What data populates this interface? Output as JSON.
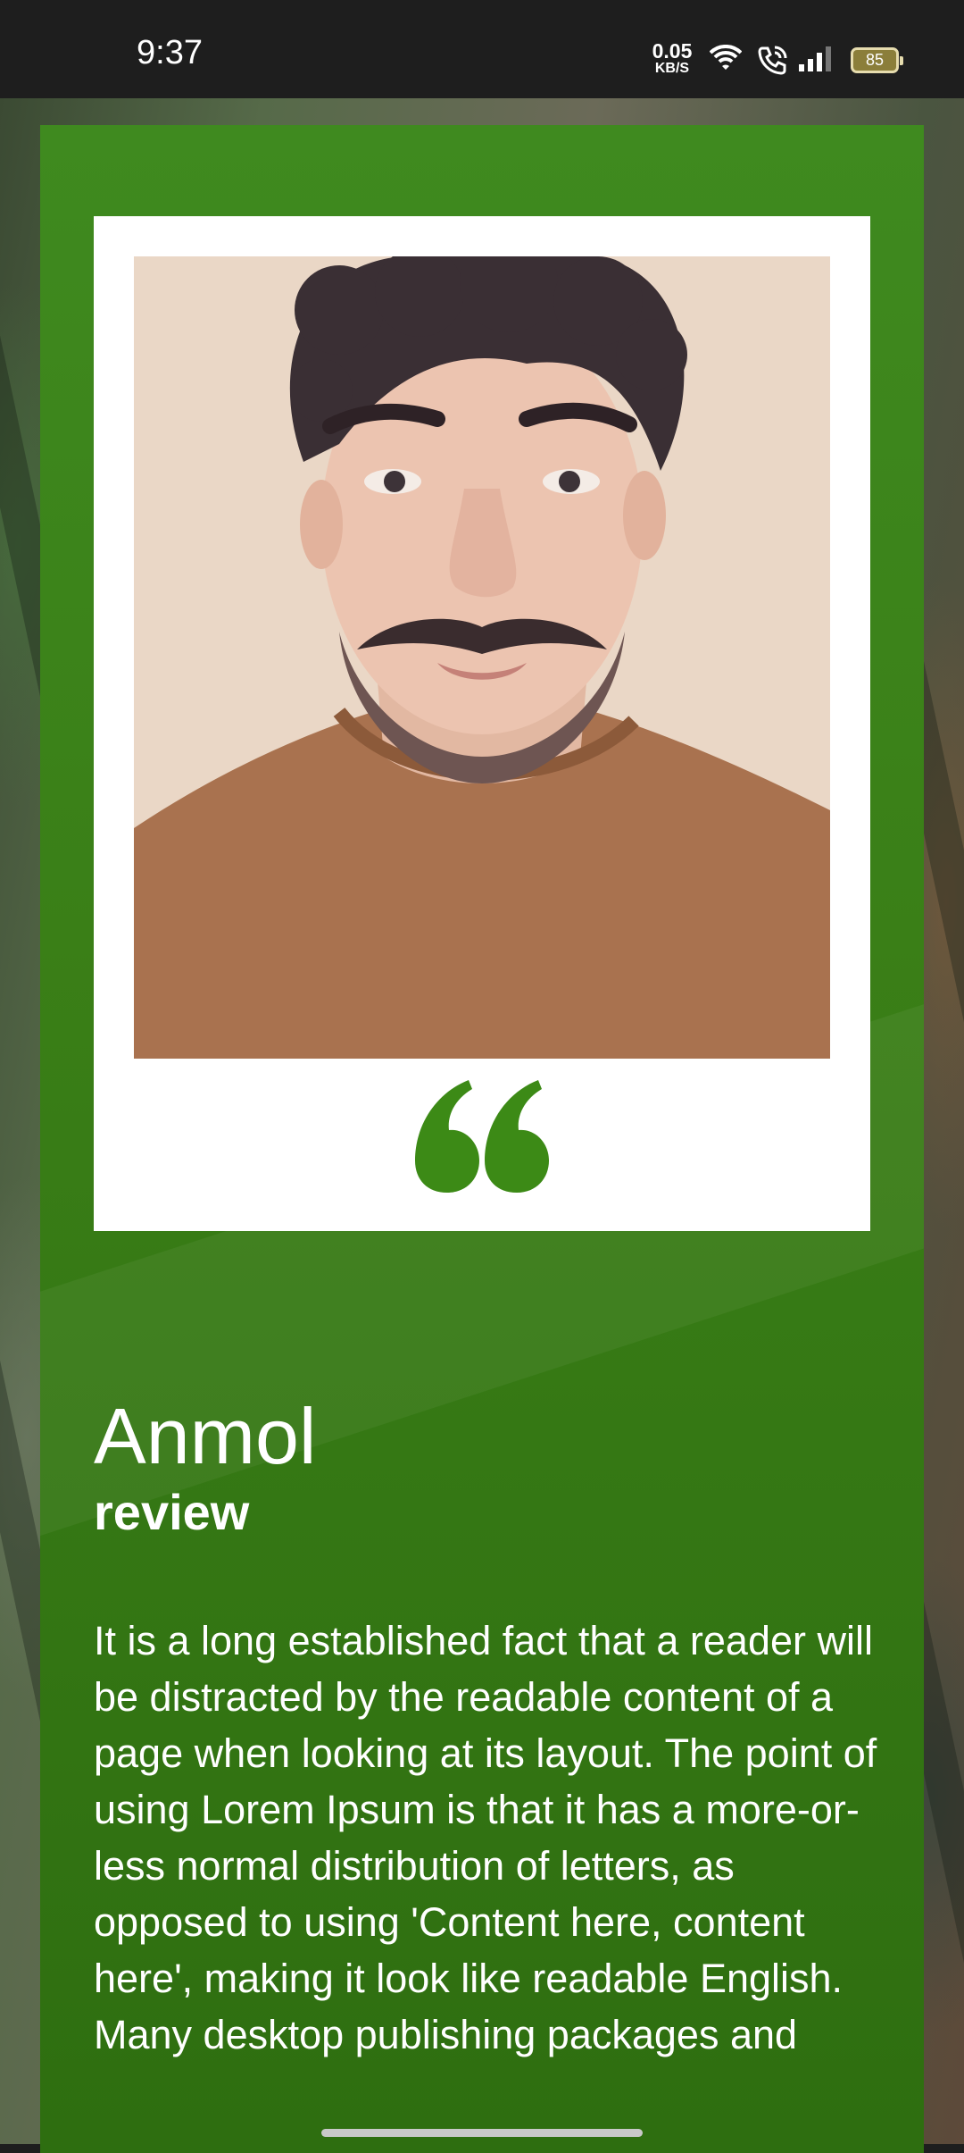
{
  "status_bar": {
    "time": "9:37",
    "net_speed_value": "0.05",
    "net_speed_unit": "KB/S",
    "battery_level": "85"
  },
  "review": {
    "name": "Anmol",
    "subtitle": "review",
    "text": "It is a long established fact that a reader will be distracted by the readable content of a page when looking at its layout. The point of using Lorem Ipsum is that it has a more-or-less normal distribution of letters, as opposed to using 'Content here, content here', making it look like readable English. Many desktop publishing packages and"
  },
  "colors": {
    "card_green": "#3f8a1f",
    "quote_green": "#3c8a16",
    "frame_white": "#ffffff"
  },
  "icons": [
    "wifi-icon",
    "call-icon",
    "signal-icon",
    "battery-icon",
    "quote-icon"
  ]
}
